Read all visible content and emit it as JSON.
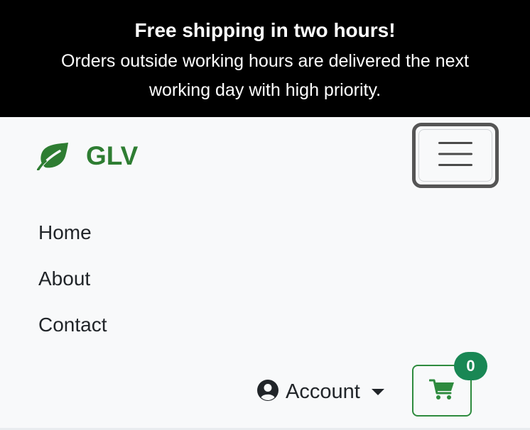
{
  "banner": {
    "title": "Free shipping in two hours!",
    "text": "Orders outside working hours are delivered the next working day with high priority."
  },
  "brand": {
    "icon": "leaf-icon",
    "name": "GLV",
    "color": "#2e7d32"
  },
  "navbar": {
    "toggler_icon": "hamburger-menu-icon",
    "links": [
      {
        "label": "Home"
      },
      {
        "label": "About"
      },
      {
        "label": "Contact"
      }
    ],
    "account": {
      "icon": "user-circle-icon",
      "label": "Account",
      "dropdown_icon": "caret-down-icon"
    },
    "cart": {
      "icon": "shopping-cart-icon",
      "count": "0",
      "accent_color": "#2e8b3e",
      "badge_color": "#198754"
    }
  }
}
